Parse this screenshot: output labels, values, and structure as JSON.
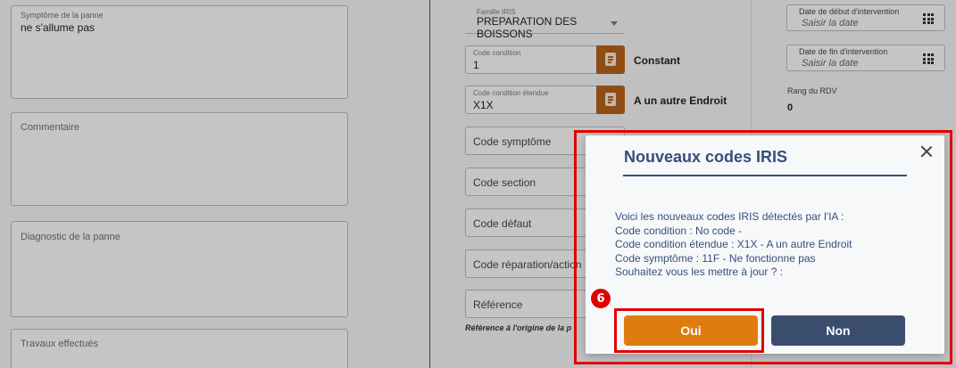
{
  "left_column": {
    "symptome_label": "Symptôme de la panne",
    "symptome_value": "ne s'allume pas",
    "commentaire_label": "Commentaire",
    "diagnostic_label": "Diagnostic de la panne",
    "travaux_label": "Travaux effectués"
  },
  "middle_column": {
    "famille_label": "Famille IRIS",
    "famille_value": "PREPARATION DES BOISSONS",
    "code_condition_label": "Code condition",
    "code_condition_value": "1",
    "code_condition_desc": "Constant",
    "code_condition_etendue_label": "Code condition étendue",
    "code_condition_etendue_value": "X1X",
    "code_condition_etendue_desc": "A un autre Endroit",
    "code_symptome_label": "Code symptôme",
    "code_section_label": "Code section",
    "code_defaut_label": "Code défaut",
    "code_reparation_label": "Code réparation/action",
    "reference_label": "Référence",
    "reference_hint": "Référence à l'origine de la p"
  },
  "right_column": {
    "date_debut_label": "Date de début d'intervention",
    "date_debut_placeholder": "Saisir la date",
    "date_fin_label": "Date de fin d'intervention",
    "date_fin_placeholder": "Saisir la date",
    "rang_rdv_label": "Rang du RDV",
    "rang_rdv_value": "0"
  },
  "modal": {
    "title": "Nouveaux codes IRIS",
    "lines": [
      "Voici les nouveaux codes IRIS détectés par l'IA :",
      "Code condition : No code -",
      "Code condition étendue : X1X - A un autre Endroit",
      "Code symptôme : 11F - Ne fonctionne pas",
      "Souhaitez vous les mettre à jour ? :"
    ],
    "oui_label": "Oui",
    "non_label": "Non"
  },
  "annotation": {
    "step_number": "6"
  },
  "colors": {
    "accent_orange": "#e07c0f",
    "code_button_brown": "#b3611c",
    "navy": "#3a4d6c",
    "title_blue": "#34507a",
    "highlight_red": "#e00000"
  }
}
